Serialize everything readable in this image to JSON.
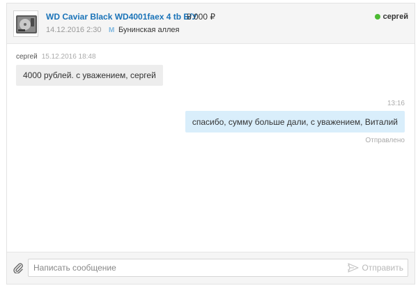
{
  "header": {
    "item_title": "WD Caviar Black WD4001faex 4 tb Б/У",
    "item_price": "8 000 ₽",
    "item_date": "14.12.2016 2:30",
    "metro_logo": "M",
    "metro_station": "Бунинская аллея",
    "user_name": "сергей",
    "user_status_color": "#4cba33",
    "thumbnail_icon": "hard-drive-icon"
  },
  "messages": [
    {
      "author": "сергей",
      "time": "15.12.2016 18:48",
      "text": "4000 рублей. с уважением, сергей",
      "direction": "incoming"
    },
    {
      "time": "13:16",
      "text": "спасибо, сумму больше дали, с уважением, Виталий",
      "status": "Отправлено",
      "direction": "outgoing"
    }
  ],
  "composer": {
    "placeholder": "Написать сообщение",
    "value": "",
    "send_label": "Отправить",
    "attach_icon": "paperclip-icon",
    "send_icon": "paper-plane-icon"
  },
  "colors": {
    "link": "#1a73b8",
    "incoming_bubble": "#ededed",
    "outgoing_bubble": "#d9eefb",
    "header_bg": "#f5f5f5"
  }
}
